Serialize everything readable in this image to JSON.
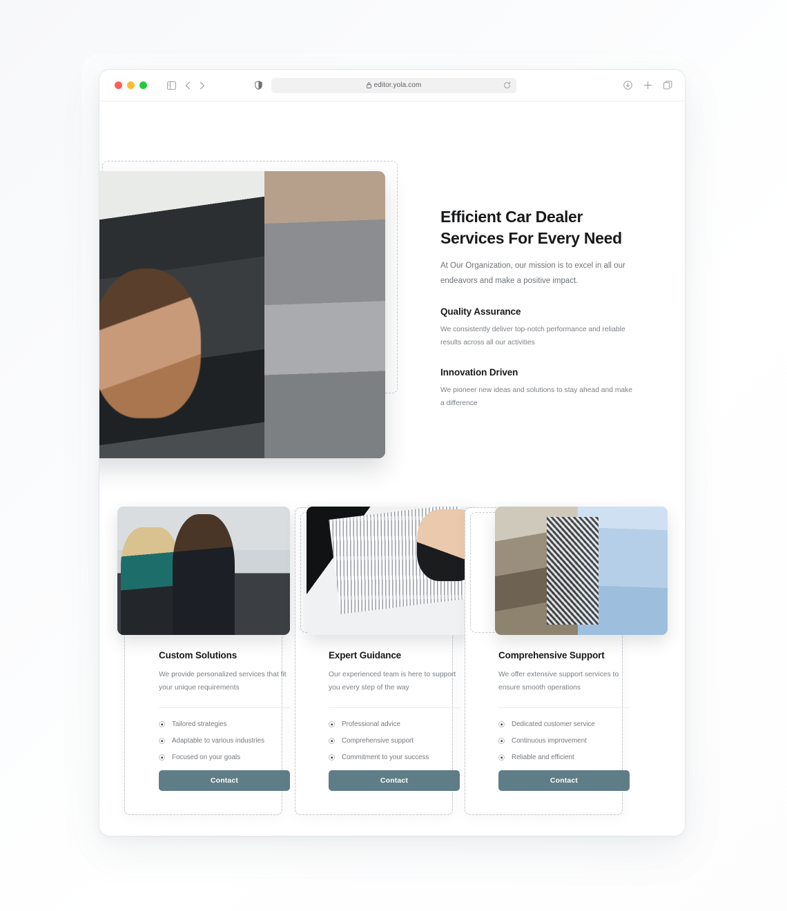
{
  "browser": {
    "url": "editor.yola.com",
    "icons": {
      "sidebar": "sidebar-icon",
      "back": "back-chevron-icon",
      "forward": "forward-chevron-icon",
      "shield": "privacy-shield-icon",
      "lock": "lock-icon",
      "reload": "reload-icon",
      "download": "download-icon",
      "newtab": "plus-icon",
      "tabs": "tab-overview-icon"
    },
    "traffic_lights": {
      "close": "#ff5f57",
      "minimize": "#febc2e",
      "maximize": "#28c840"
    }
  },
  "hero": {
    "title": "Efficient Car Dealer Services For Every Need",
    "subtitle": "At Our Organization, our mission is to excel in all our endeavors and make a positive impact.",
    "image_alt": "car-dealer-handing-keys-photo",
    "features": [
      {
        "title": "Quality Assurance",
        "body": "We consistently deliver top-notch performance and reliable results across all our activities"
      },
      {
        "title": "Innovation Driven",
        "body": "We pioneer new ideas and solutions to stay ahead and make a difference"
      }
    ]
  },
  "cards": [
    {
      "title": "Custom Solutions",
      "desc": "We provide personalized services that fit your unique requirements",
      "image_alt": "business-team-meeting-photo",
      "bullets": [
        "Tailored strategies",
        "Adaptable to various industries",
        "Focused on your goals"
      ],
      "button": "Contact"
    },
    {
      "title": "Expert Guidance",
      "desc": "Our experienced team is here to support you every step of the way",
      "image_alt": "signing-contract-photo",
      "bullets": [
        "Professional advice",
        "Comprehensive support",
        "Commitment to your success"
      ],
      "button": "Contact"
    },
    {
      "title": "Comprehensive Support",
      "desc": "We offer extensive support services to ensure smooth operations",
      "image_alt": "handshake-agreement-photo",
      "bullets": [
        "Dedicated customer service",
        "Continuous improvement",
        "Reliable and efficient"
      ],
      "button": "Contact"
    }
  ],
  "theme": {
    "accent": "#5f7d86",
    "heading": "#17181a",
    "body_text": "#7b8086",
    "dashed_outline": "#c6cbd0",
    "page_bg": "#ffffff"
  }
}
